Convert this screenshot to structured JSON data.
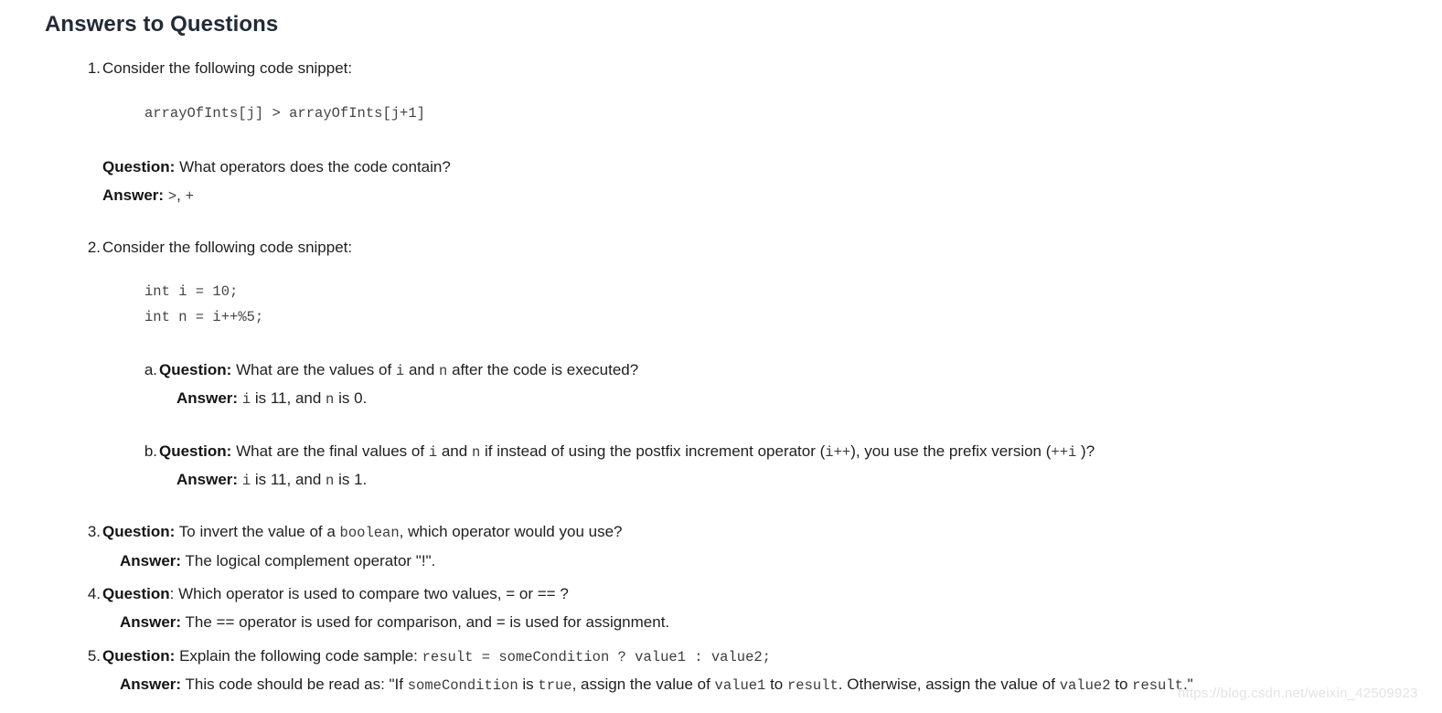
{
  "document": {
    "title": "Answers to Questions",
    "watermark": "https://blog.csdn.net/weixin_42509923",
    "labels": {
      "question": "Question:",
      "question_no_colon": "Question",
      "answer": "Answer:",
      "colon": ":"
    }
  },
  "items": [
    {
      "marker": "1.",
      "lead": "Consider the following code snippet:",
      "code": "arrayOfInts[j] > arrayOfInts[j+1]",
      "question": "What operators does the code contain?",
      "answer_prefix": "",
      "answer_code_1": ">",
      "answer_mid": ", ",
      "answer_code_2": "+"
    },
    {
      "marker": "2.",
      "lead": "Consider the following code snippet:",
      "code_line_1": "int i = 10;",
      "code_line_2": "int n = i++%5;",
      "sub": [
        {
          "marker": "a.",
          "q_part_1": "What are the values of ",
          "q_code_1": "i",
          "q_part_2": " and ",
          "q_code_2": "n",
          "q_part_3": " after the code is executed?",
          "a_code_1": "i",
          "a_part_1": " is 11, and ",
          "a_code_2": "n",
          "a_part_2": " is 0."
        },
        {
          "marker": "b.",
          "q_part_1": "What are the final values of ",
          "q_code_1": "i",
          "q_part_2": " and ",
          "q_code_2": "n",
          "q_part_3": " if instead of using the postfix increment operator (",
          "q_code_3": "i++",
          "q_part_4": "), you use the prefix version (",
          "q_code_4": "++i",
          "q_part_5": " )?",
          "a_code_1": "i",
          "a_part_1": " is 11, and ",
          "a_code_2": "n",
          "a_part_2": " is 1."
        }
      ]
    },
    {
      "marker": "3.",
      "q_part_1": "To invert the value of a ",
      "q_code_1": "boolean",
      "q_part_2": ", which operator would you use?",
      "answer": "The logical complement operator \"!\"."
    },
    {
      "marker": "4.",
      "q_part_1": "Which operator is used to compare two values, = or == ?",
      "answer": "The == operator is used for comparison, and = is used for assignment."
    },
    {
      "marker": "5.",
      "q_part_1": "Explain the following code sample: ",
      "q_code_1": "result = someCondition ? value1 : value2;",
      "a_part_1": "This code should be read as: \"If ",
      "a_code_1": "someCondition",
      "a_part_2": " is ",
      "a_code_2": "true",
      "a_part_3": ", assign the value of ",
      "a_code_3": "value1",
      "a_part_4": " to ",
      "a_code_4": "result",
      "a_part_5": ". Otherwise, assign the value of ",
      "a_code_5": "value2",
      "a_part_6": " to ",
      "a_code_6": "result",
      "a_part_7": ".\""
    }
  ]
}
